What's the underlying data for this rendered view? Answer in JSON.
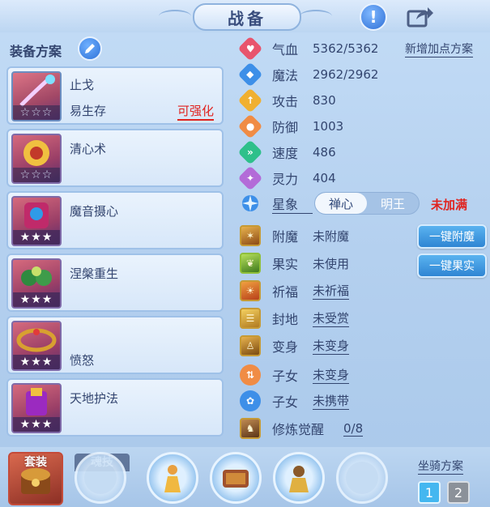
{
  "header": {
    "title": "战备",
    "info_icon": "exclamation-icon",
    "share_icon": "share-icon"
  },
  "scheme": {
    "label": "装备方案",
    "edit_icon": "pencil-icon"
  },
  "cards": [
    {
      "name": "止戈",
      "sub": "易生存",
      "tag": "可强化",
      "stars": "☆☆☆"
    },
    {
      "name": "清心术",
      "stars": "☆☆☆"
    },
    {
      "name": "魔音摄心",
      "stars": "★★★"
    },
    {
      "name": "涅槃重生",
      "stars": "★★★"
    },
    {
      "name": "愤怒",
      "sub_bottom": "愤怒",
      "stars": "★★★"
    },
    {
      "name": "天地护法",
      "stars": "★★★"
    }
  ],
  "stats": [
    {
      "name": "气血",
      "value": "5362/5362",
      "color": "#e8546d",
      "glyph": "♥"
    },
    {
      "name": "魔法",
      "value": "2962/2962",
      "color": "#3d8fe8",
      "glyph": "◆"
    },
    {
      "name": "攻击",
      "value": "830",
      "color": "#f0b030",
      "glyph": "↑"
    },
    {
      "name": "防御",
      "value": "1003",
      "color": "#f08c45",
      "glyph": "●"
    },
    {
      "name": "速度",
      "value": "486",
      "color": "#2ec08a",
      "glyph": "»"
    },
    {
      "name": "灵力",
      "value": "404",
      "color": "#b36bd8",
      "glyph": "✦"
    }
  ],
  "add_points_link": "新增加点方案",
  "constellation": {
    "name": "星象",
    "options": [
      "禅心",
      "明王"
    ],
    "selected": "禅心",
    "status": "未加满"
  },
  "buffs": [
    {
      "name": "附魔",
      "value": "未附魔",
      "underline": false
    },
    {
      "name": "果实",
      "value": "未使用",
      "underline": false
    },
    {
      "name": "祈福",
      "value": "未祈福",
      "underline": true
    },
    {
      "name": "封地",
      "value": "未受赏",
      "underline": true
    },
    {
      "name": "变身",
      "value": "未变身",
      "underline": true
    }
  ],
  "children": [
    {
      "name": "子女",
      "value": "未变身",
      "color": "#f08c45"
    },
    {
      "name": "子女",
      "value": "未携带",
      "color": "#3d8fe8"
    }
  ],
  "awaken": {
    "name": "修炼觉醒",
    "value": "0/8"
  },
  "quick_buttons": {
    "enchant": "一键附魔",
    "fruit": "一键果实"
  },
  "bottom": {
    "suit_label": "套装",
    "skill_tab": "魂技",
    "mount_label": "坐骑方案",
    "mount_1": "1",
    "mount_2": "2"
  }
}
